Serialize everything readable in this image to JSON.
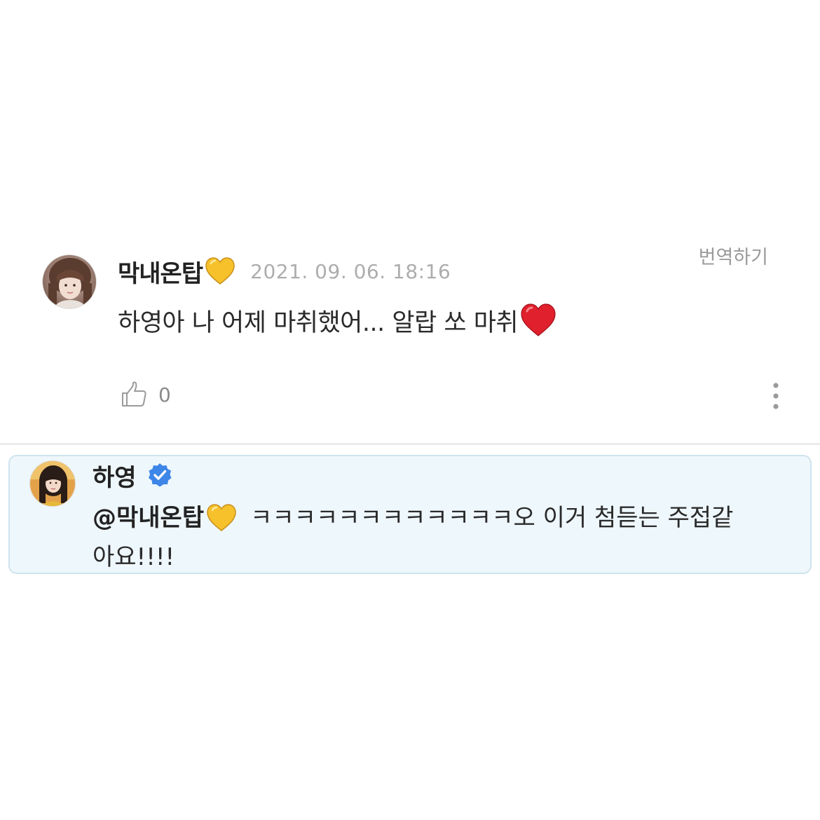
{
  "comment": {
    "avatar_icon": "user-avatar-photo",
    "author": "막내온탑",
    "author_emoji": "yellow-heart-icon",
    "timestamp": "2021. 09. 06. 18:16",
    "translate_label": "번역하기",
    "body": "하영아 나 어제 마취했어... 알랍 쏘 마취",
    "body_emoji": "red-heart-icon",
    "like_icon": "thumbs-up-icon",
    "like_count": "0",
    "more_icon": "more-vertical-icon"
  },
  "reply": {
    "avatar_icon": "artist-avatar-photo",
    "author": "하영",
    "badge_icon": "verified-badge-icon",
    "mention": "@막내온탑",
    "mention_emoji": "yellow-heart-icon",
    "text_line1": "ㅋㅋㅋㅋㅋㅋㅋㅋㅋㅋㅋㅋ오 이거 첨듣는 주접같",
    "text_line2": "아요!!!!"
  },
  "colors": {
    "reply_background": "#eef7fc",
    "reply_border": "#cfe3ee",
    "verified_blue": "#3d86e8",
    "timestamp_gray": "#adadad",
    "yellow_heart": "#f6c12b",
    "red_heart": "#e0202c"
  }
}
